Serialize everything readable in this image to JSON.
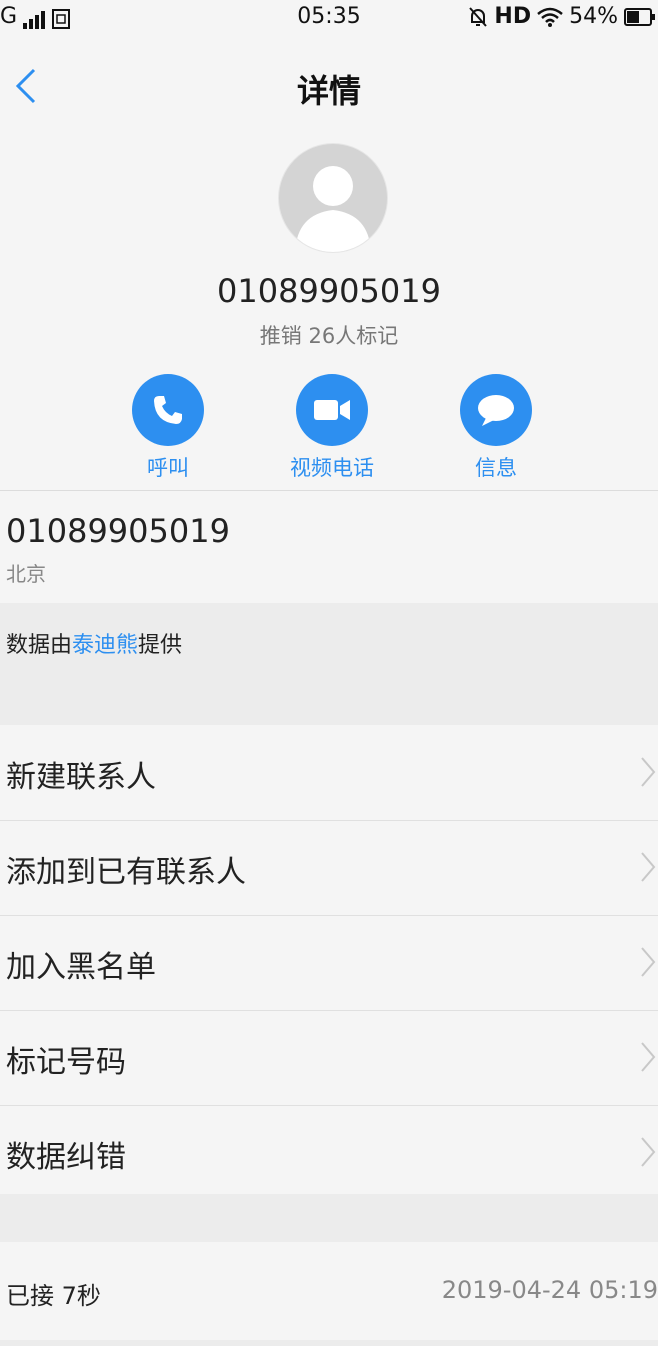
{
  "status_bar": {
    "network": "G",
    "sim_icon": "sim-card-icon",
    "time": "05:35",
    "hd": "HD",
    "battery": "54%",
    "battery_level": 0.54
  },
  "nav": {
    "title": "详情",
    "back_icon": "chevron-left-icon"
  },
  "contact": {
    "number": "01089905019",
    "tag": "推销 26人标记"
  },
  "actions": [
    {
      "label": "呼叫",
      "icon": "phone-icon"
    },
    {
      "label": "视频电话",
      "icon": "video-call-icon"
    },
    {
      "label": "信息",
      "icon": "message-icon"
    }
  ],
  "number_row": {
    "number": "01089905019",
    "location": "北京"
  },
  "provider": {
    "prefix": "数据由",
    "link": "泰迪熊",
    "suffix": "提供"
  },
  "menu": [
    {
      "label": "新建联系人"
    },
    {
      "label": "添加到已有联系人"
    },
    {
      "label": "加入黑名单"
    },
    {
      "label": "标记号码"
    },
    {
      "label": "数据纠错"
    }
  ],
  "call_record": {
    "status": "已接 7秒",
    "date": "2019-04-24 05:19"
  },
  "colors": {
    "accent": "#2d8ff0",
    "background": "#f5f5f5",
    "section_gap": "#ececec"
  }
}
